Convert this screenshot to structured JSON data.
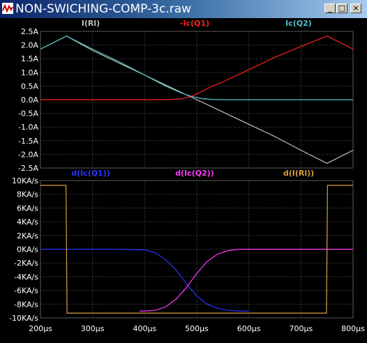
{
  "window": {
    "title": "NON-SWICHING-COMP-3c.raw",
    "minimize_label": "_",
    "maximize_label": "□",
    "close_label": "×"
  },
  "colors": {
    "background": "#000000",
    "grid": "#5a5a5a",
    "ic_q2": "#4fc1c9",
    "neg_ic_q1": "#ff2020",
    "i_rl": "#c0c0c0",
    "d_ic_q1": "#2a35ff",
    "d_ic_q2": "#ff3cff",
    "d_i_rl": "#d8a040"
  },
  "chart_data": [
    {
      "type": "line",
      "title": "",
      "x_unit": "µs",
      "xlim": [
        200,
        800
      ],
      "ylim": [
        -2.5,
        2.5
      ],
      "y_ticks": [
        "2.5A",
        "2.0A",
        "1.5A",
        "1.0A",
        "0.5A",
        "0.0A",
        "-0.5A",
        "-1.0A",
        "-1.5A",
        "-2.0A",
        "-2.5A"
      ],
      "y_tick_values": [
        2.5,
        2.0,
        1.5,
        1.0,
        0.5,
        0.0,
        -0.5,
        -1.0,
        -1.5,
        -2.0,
        -2.5
      ],
      "series": [
        {
          "name": "I(Rl)",
          "color": "#c0c0c0",
          "x": [
            200,
            250,
            300,
            350,
            400,
            450,
            500,
            550,
            600,
            650,
            700,
            750,
            800
          ],
          "y": [
            1.85,
            2.33,
            1.8,
            1.35,
            0.9,
            0.45,
            0.0,
            -0.45,
            -0.9,
            -1.35,
            -1.85,
            -2.33,
            -1.85
          ]
        },
        {
          "name": "-Ic(Q1)",
          "color": "#ff2020",
          "x": [
            200,
            250,
            300,
            350,
            400,
            440,
            470,
            490,
            510,
            530,
            550,
            600,
            650,
            700,
            750,
            800
          ],
          "y": [
            0.0,
            0.0,
            0.0,
            0.0,
            0.0,
            0.0,
            0.03,
            0.12,
            0.3,
            0.5,
            0.65,
            1.1,
            1.55,
            1.95,
            2.33,
            1.85
          ]
        },
        {
          "name": "Ic(Q2)",
          "color": "#4fc1c9",
          "x": [
            200,
            250,
            300,
            350,
            400,
            440,
            470,
            490,
            510,
            530,
            550,
            600,
            650,
            700,
            750,
            800
          ],
          "y": [
            1.85,
            2.33,
            1.85,
            1.4,
            0.9,
            0.5,
            0.25,
            0.12,
            0.04,
            0.01,
            0.0,
            0.0,
            0.0,
            0.0,
            0.0,
            0.0
          ]
        }
      ]
    },
    {
      "type": "line",
      "title": "",
      "x_unit": "µs",
      "xlim": [
        200,
        800
      ],
      "ylim": [
        -10,
        10
      ],
      "x_ticks": [
        "200µs",
        "300µs",
        "400µs",
        "500µs",
        "600µs",
        "700µs",
        "800µs"
      ],
      "x_tick_values": [
        200,
        300,
        400,
        500,
        600,
        700,
        800
      ],
      "y_ticks": [
        "10KA/s",
        "8KA/s",
        "6KA/s",
        "4KA/s",
        "2KA/s",
        "0KA/s",
        "-2KA/s",
        "-4KA/s",
        "-6KA/s",
        "-8KA/s",
        "-10KA/s"
      ],
      "y_tick_values": [
        10,
        8,
        6,
        4,
        2,
        0,
        -2,
        -4,
        -6,
        -8,
        -10
      ],
      "series": [
        {
          "name": "d(Ic(Q1))",
          "color": "#2a35ff",
          "x": [
            200,
            250,
            300,
            350,
            400,
            420,
            440,
            460,
            480,
            500,
            520,
            540,
            560,
            580,
            600
          ],
          "y": [
            0.0,
            0.0,
            0.0,
            0.0,
            -0.1,
            -0.5,
            -1.5,
            -3.0,
            -5.0,
            -6.8,
            -8.0,
            -8.6,
            -8.9,
            -9.0,
            -9.0
          ]
        },
        {
          "name": "d(Ic(Q2))",
          "color": "#ff3cff",
          "x": [
            390,
            400,
            420,
            440,
            460,
            480,
            500,
            520,
            540,
            560,
            580,
            600,
            650,
            700,
            750,
            800
          ],
          "y": [
            -9.0,
            -9.0,
            -8.9,
            -8.4,
            -7.3,
            -5.6,
            -3.5,
            -1.8,
            -0.7,
            -0.2,
            0.0,
            0.0,
            0.0,
            0.0,
            0.0,
            0.0
          ]
        },
        {
          "name": "d(I(Rl))",
          "color": "#d8a040",
          "x": [
            200,
            248,
            249,
            251,
            252,
            300,
            400,
            500,
            600,
            700,
            748,
            749,
            751,
            800
          ],
          "y": [
            9.3,
            9.3,
            9.3,
            -9.3,
            -9.3,
            -9.3,
            -9.3,
            -9.3,
            -9.3,
            -9.3,
            -9.3,
            -9.3,
            9.3,
            9.3
          ]
        }
      ]
    }
  ]
}
